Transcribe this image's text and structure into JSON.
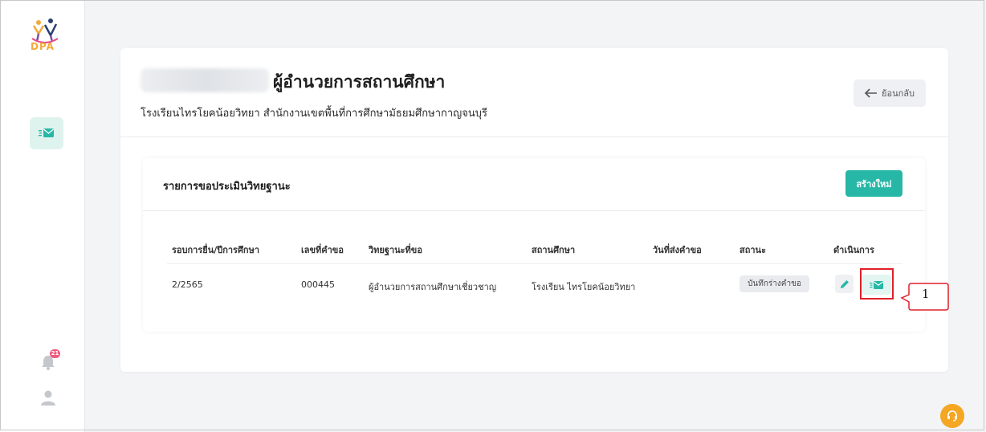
{
  "sidebar": {
    "logo_text": "DPA",
    "items": [
      {
        "icon": "mail-icon",
        "active": true
      }
    ],
    "notification_count": "21",
    "bottom_icons": [
      "bell-icon",
      "user-icon"
    ]
  },
  "header": {
    "title": "ผู้อำนวยการสถานศึกษา",
    "subtitle": "โรงเรียนไทรโยคน้อยวิทยา สำนักงานเขตพื้นที่การศึกษามัธยมศึกษากาญจนบุรี",
    "back_label": "ย้อนกลับ"
  },
  "list": {
    "title": "รายการขอประเมินวิทยฐานะ",
    "new_label": "สร้างใหม่",
    "columns": [
      "รอบการยื่น/ปีการศึกษา",
      "เลขที่คำขอ",
      "วิทยฐานะที่ขอ",
      "สถานศึกษา",
      "วันที่ส่งคำขอ",
      "สถานะ",
      "ดำเนินการ"
    ],
    "rows": [
      {
        "round": "2/2565",
        "request_no": "000445",
        "rank": "ผู้อำนวยการสถานศึกษาเชี่ยวชาญ",
        "school": "โรงเรียน ไทรโยคน้อยวิทยา",
        "sent_date": "",
        "status": "บันทึกร่างคำขอ"
      }
    ]
  },
  "annotation": {
    "label": "1",
    "color": "#e0202a"
  },
  "colors": {
    "accent": "#27b7a7",
    "help": "#f5a623",
    "badge": "#f05a7e"
  }
}
